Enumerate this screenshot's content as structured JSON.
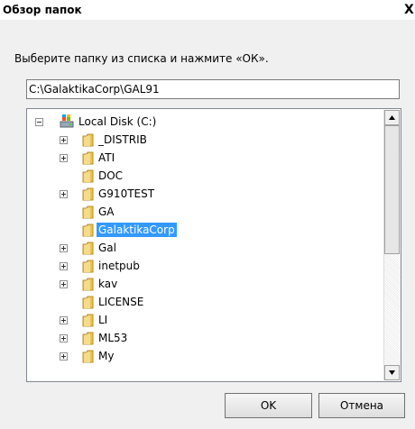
{
  "dialog": {
    "title": "Обзор папок",
    "close_label": "X",
    "prompt": "Выберите папку из списка и нажмите «ОК».",
    "path_value": "C:\\GalaktikaCorp\\GAL91"
  },
  "tree": {
    "root": {
      "label": "Local Disk (C:)",
      "expanded": true,
      "icon": "drive-icon"
    },
    "items": [
      {
        "label": "_DISTRIB",
        "expandable": true,
        "selected": false
      },
      {
        "label": "ATI",
        "expandable": true,
        "selected": false
      },
      {
        "label": "DOC",
        "expandable": false,
        "selected": false
      },
      {
        "label": "G910TEST",
        "expandable": true,
        "selected": false
      },
      {
        "label": "GA",
        "expandable": false,
        "selected": false
      },
      {
        "label": "GalaktikaCorp",
        "expandable": false,
        "selected": true
      },
      {
        "label": "Gal",
        "expandable": true,
        "selected": false
      },
      {
        "label": "inetpub",
        "expandable": true,
        "selected": false
      },
      {
        "label": "kav",
        "expandable": true,
        "selected": false
      },
      {
        "label": "LICENSE",
        "expandable": false,
        "selected": false
      },
      {
        "label": "LI",
        "expandable": true,
        "selected": false
      },
      {
        "label": "ML53",
        "expandable": true,
        "selected": false
      },
      {
        "label": "My",
        "expandable": true,
        "selected": false
      }
    ]
  },
  "buttons": {
    "ok": "OK",
    "cancel": "Отмена"
  },
  "colors": {
    "selection": "#3399ff",
    "folder": "#e8c25a"
  }
}
